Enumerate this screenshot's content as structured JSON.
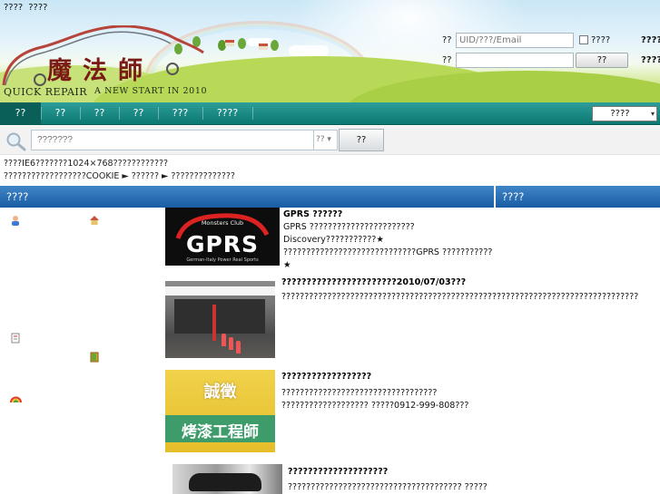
{
  "top_links": [
    "????",
    "????"
  ],
  "logo": {
    "cn_text": "魔法師",
    "en_left": "QUICK REPAIR",
    "en_right": "A NEW START IN 2010"
  },
  "login": {
    "user_label": "??",
    "user_placeholder": "UID/???/Email",
    "pass_label": "??",
    "remember_label": "????",
    "submit_label": "??",
    "side_label_1": "????",
    "side_label_2": "????"
  },
  "nav": {
    "items": [
      "??",
      "??",
      "??",
      "??",
      "???",
      "????"
    ],
    "select_value": "????"
  },
  "search": {
    "placeholder": "???????",
    "type_value": "?? ▾",
    "button_label": "??"
  },
  "notice": {
    "line1": "????IE6???????1024×768????????????",
    "line2_prefix": "??????????????????COOKIE",
    "line2_link1": "??????",
    "line2_link2": "??????????????"
  },
  "columns": {
    "left_title": "????",
    "right_title": "????"
  },
  "articles": [
    {
      "title": "GPRS ??????",
      "summary": "GPRS ???????????????????????Discovery???????????★ ?????????????????????????????GPRS ???????????★",
      "thumb_text": "GPRS",
      "thumb_sub": "Monsters Club",
      "thumb_caption": "German-Italy Power Real Sports"
    },
    {
      "title": "???????????????????????2010/07/03???",
      "summary": "??????????????????????????????????????????????????????????????????????????????"
    },
    {
      "title": "??????????????????",
      "summary": "?????????????????????????????????? ??????????????????? ?????0912-999-808???",
      "thumb_text_1": "誠徵",
      "thumb_text_2": "烤漆工程師"
    },
    {
      "title": "????????????????????",
      "summary": "?????????????????????????????????????? ?????"
    }
  ],
  "colors": {
    "nav_bg": "#0b7770",
    "column_header": "#1a5ca3",
    "logo_text": "#7a1b16"
  }
}
